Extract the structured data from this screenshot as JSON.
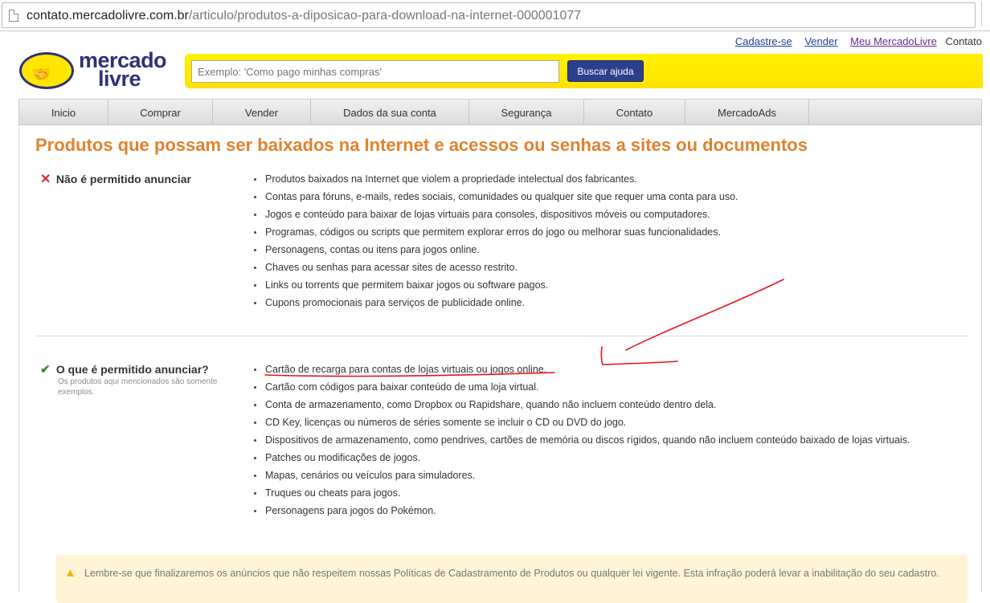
{
  "browser": {
    "url_domain": "contato.mercadolivre.com.br",
    "url_path": "/articulo/produtos-a-diposicao-para-download-na-internet-000001077"
  },
  "toplinks": {
    "cadastre": "Cadastre-se",
    "vender": "Vender",
    "meu": "Meu MercadoLivre",
    "contato": "Contato"
  },
  "logo": {
    "line1": "mercado",
    "line2": "livre"
  },
  "search": {
    "placeholder": "Exemplo: 'Como pago minhas compras'",
    "button": "Buscar ajuda"
  },
  "nav": [
    "Inicio",
    "Comprar",
    "Vender",
    "Dados da sua conta",
    "Segurança",
    "Contato",
    "MercadoAds"
  ],
  "title": "Produtos que possam ser baixados na Internet e acessos ou senhas a sites ou documentos",
  "not_allowed": {
    "heading": "Não é permitido anunciar",
    "items": [
      "Produtos baixados na Internet que violem a propriedade intelectual dos fabricantes.",
      "Contas para fóruns, e-mails, redes sociais, comunidades ou qualquer site que requer uma conta para uso.",
      "Jogos e conteúdo para baixar de lojas virtuais para consoles, dispositivos móveis ou computadores.",
      "Programas, códigos ou scripts que permitem explorar erros do jogo ou melhorar suas funcionalidades.",
      "Personagens, contas ou itens para jogos online.",
      "Chaves ou senhas para acessar sites de acesso restrito.",
      "Links ou torrents que permitem baixar jogos ou software pagos.",
      "Cupons promocionais para serviços de publicidade online."
    ]
  },
  "allowed": {
    "heading": "O que é permitido anunciar?",
    "note": "Os produtos aqui mencionados são somente exemplos.",
    "items": [
      "Cartão de recarga para contas de lojas virtuais ou jogos online.",
      "Cartão com códigos para baixar conteúdo de uma loja virtual.",
      "Conta de armazenamento, como Dropbox ou Rapidshare, quando não incluem conteúdo dentro dela.",
      "CD Key, licenças ou números de séries somente se incluir o CD ou DVD do jogo.",
      "Dispositivos de armazenamento, como pendrives, cartões de memória ou discos rígidos, quando não incluem conteúdo baixado de lojas virtuais.",
      "Patches ou modificações de jogos.",
      "Mapas, cenários ou veículos para simuladores.",
      "Truques ou cheats para jogos.",
      "Personagens para jogos do Pokémon."
    ]
  },
  "notice": "Lembre-se que finalizaremos os anúncios que não respeitem nossas Políticas de Cadastramento de Produtos ou qualquer lei vigente. Esta infração poderá levar a inabilitação do seu cadastro.",
  "icons": {
    "not_allowed": "x-icon",
    "allowed": "check-icon",
    "notice": "warning-icon",
    "page": "page-icon"
  },
  "colors": {
    "title": "#e0822d",
    "brand_blue": "#2d3277",
    "brand_yellow": "#ffe600",
    "annotation": "#e8131b"
  }
}
